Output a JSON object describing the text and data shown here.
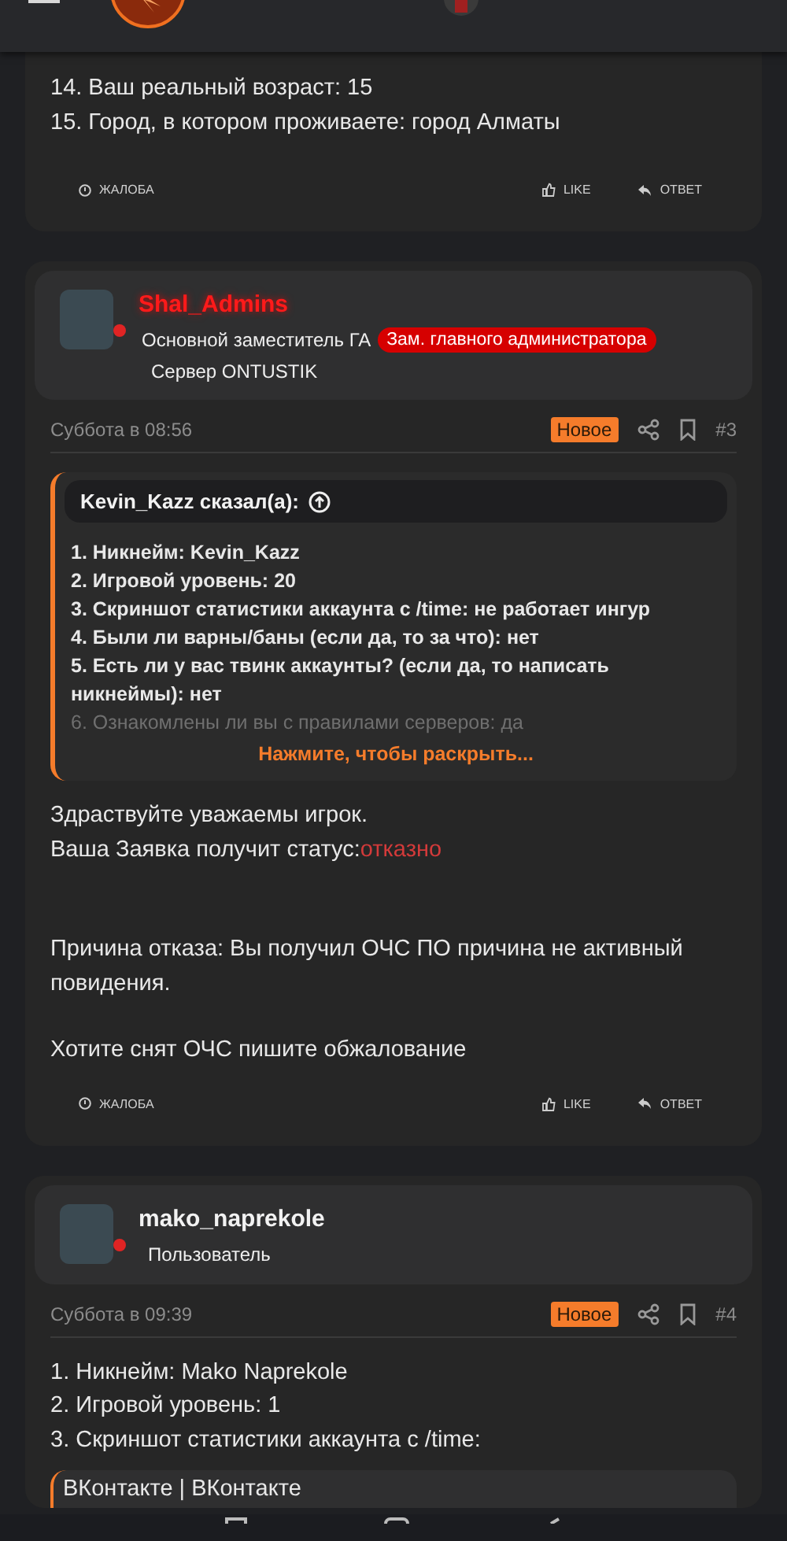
{
  "posts": [
    {
      "body": [
        {
          "kind": "paragraph",
          "lines": [
            {
              "text": "14. Ваш реальный возраст: 15"
            },
            {
              "text": "15. Город, в котором проживаете: город Алматы"
            }
          ]
        }
      ],
      "actions": {
        "report": "ЖАЛОБА",
        "like": "LIKE",
        "reply": "ОТВЕТ"
      }
    },
    {
      "author": {
        "name": "Shal_Admins",
        "kind": "admin",
        "online": true,
        "title": "Основной заместитель ГА",
        "badge": "Зам. главного администратора",
        "server": "Сервер ONTUSTIK"
      },
      "meta": {
        "date": "Суббота в 08:56",
        "new_label": "Новое",
        "number": "#3"
      },
      "quote": {
        "author": "Kevin_Kazz сказал(а):",
        "lines": [
          {
            "text": "1. Никнейм: Kevin_Kazz",
            "faded": false
          },
          {
            "text": "2. Игровой уровень: 20",
            "faded": false
          },
          {
            "text": "3. Скриншот статистики аккаунта с /time: не работает ингур",
            "faded": false
          },
          {
            "text": "4. Были ли варны/баны (если да, то за что): нет",
            "faded": false
          },
          {
            "text": "5. Есть ли у вас твинк аккаунты? (если да, то написать никнеймы): нет",
            "faded": false
          },
          {
            "text": "6. Ознакомлены ли вы с правилами серверов: да",
            "faded": true
          }
        ],
        "expand": "Нажмите, чтобы раскрыть..."
      },
      "body": [
        {
          "kind": "paragraph",
          "lines": [
            {
              "text": "Здраствуйте уважаемы игрок."
            },
            {
              "text": "Ваша Заявка получит статус:",
              "status": "отказно"
            }
          ]
        },
        {
          "kind": "break"
        },
        {
          "kind": "break"
        },
        {
          "kind": "paragraph",
          "lines": [
            {
              "text": "Причина отказа: Вы получил ОЧС ПО причина не активный повидения."
            }
          ]
        },
        {
          "kind": "break"
        },
        {
          "kind": "paragraph",
          "lines": [
            {
              "text": "Хотите снят ОЧС пишите обжалование"
            }
          ]
        }
      ],
      "actions": {
        "report": "ЖАЛОБА",
        "like": "LIKE",
        "reply": "ОТВЕТ"
      }
    },
    {
      "author": {
        "name": "mako_naprekole",
        "kind": "user",
        "online": true,
        "title": "Пользователь"
      },
      "meta": {
        "date": "Суббота в 09:39",
        "new_label": "Новое",
        "number": "#4"
      },
      "body": [
        {
          "kind": "paragraph",
          "lines": [
            {
              "text": "1. Никнейм: Mako Naprekole"
            },
            {
              "text": "2. Игровой уровень: 1"
            },
            {
              "text": "3. Скриншот статистики аккаунта с /time:"
            }
          ]
        },
        {
          "kind": "embed",
          "text": "ВКонтакте | ВКонтакте"
        }
      ]
    }
  ]
}
